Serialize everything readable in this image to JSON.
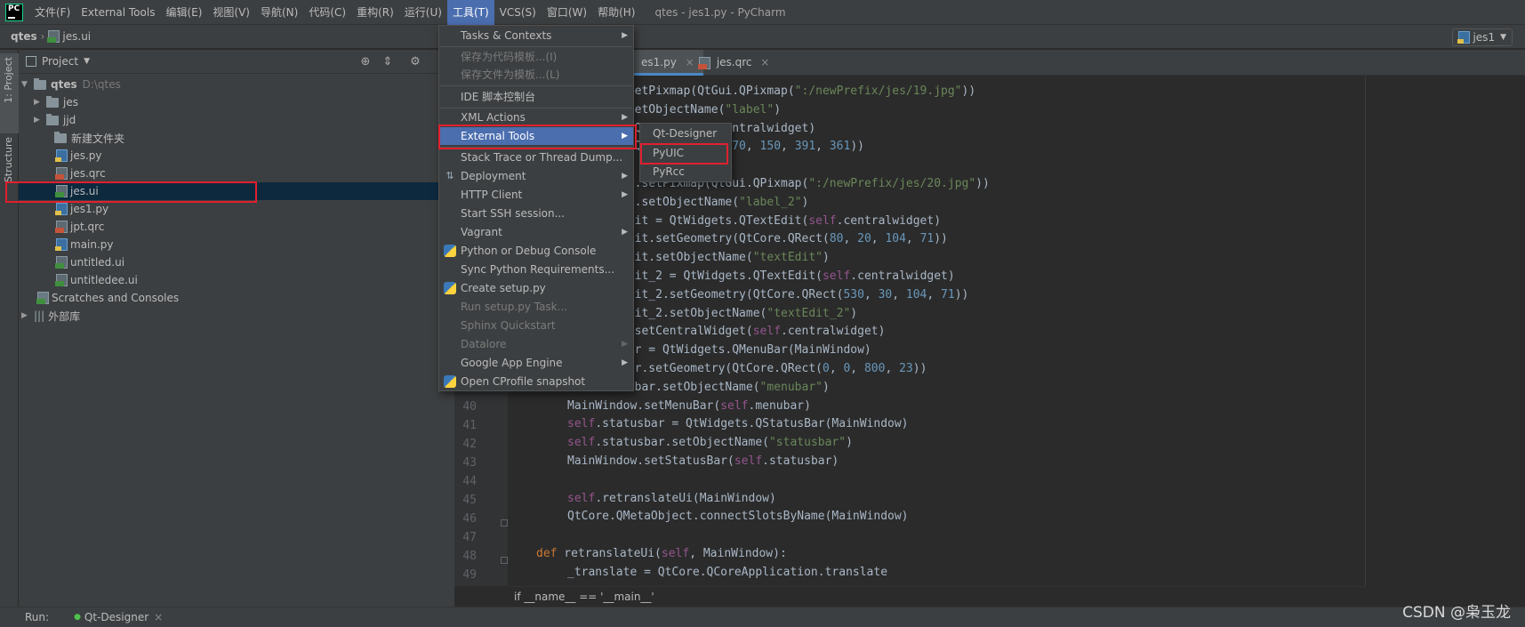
{
  "app": {
    "logo": "PC",
    "window_title": "qtes - jes1.py - PyCharm"
  },
  "menubar": [
    "文件(F)",
    "External Tools",
    "编辑(E)",
    "视图(V)",
    "导航(N)",
    "代码(C)",
    "重构(R)",
    "运行(U)",
    "工具(T)",
    "VCS(S)",
    "窗口(W)",
    "帮助(H)"
  ],
  "navbar": {
    "root": "qtes",
    "file": "jes.ui",
    "run_config": "jes1"
  },
  "sidebar": {
    "project_tab": "1: Project",
    "structure_tab": "Structure"
  },
  "project": {
    "title": "Project",
    "root": {
      "name": "qtes",
      "path": "D:\\qtes"
    },
    "items": [
      "jes",
      "jjd",
      "新建文件夹",
      "jes.py",
      "jes.qrc",
      "jes.ui",
      "jes1.py",
      "jpt.qrc",
      "main.py",
      "untitled.ui",
      "untitledee.ui"
    ],
    "scratches": "Scratches and Consoles",
    "external_libs": "外部库"
  },
  "editor_tabs": [
    "es1.py",
    "jes.qrc"
  ],
  "tools_menu": {
    "items": [
      "Tasks & Contexts",
      "保存为代码模板...(I)",
      "保存文件为模板...(L)",
      "IDE 脚本控制台",
      "XML Actions",
      "External Tools",
      "Stack Trace or Thread Dump...",
      "Deployment",
      "HTTP Client",
      "Start SSH session...",
      "Vagrant",
      "Python or Debug Console",
      "Sync Python Requirements...",
      "Create setup.py",
      "Run setup.py Task...",
      "Sphinx Quickstart",
      "Datalore",
      "Google App Engine",
      "Open CProfile snapshot"
    ]
  },
  "external_tools_menu": {
    "items": [
      "Qt-Designer",
      "PyUIC",
      "PyRcc"
    ]
  },
  "code": {
    "line_numbers": [
      "40",
      "41",
      "42",
      "43",
      "44",
      "45",
      "46",
      "47",
      "48",
      "49"
    ],
    "visible": [
      ".setPixmap(QtGui.QPixmap(\":/newPrefix/jes/19.jpg\"))",
      ".setObjectName(\"label\")",
      "s.QLabel(self.centralwidget)",
      "y(QtCore.QRect(370, 150, 391, 361))",
      ")",
      "_2.setPixmap(QtGui.QPixmap(\":/newPrefix/jes/20.jpg\"))",
      "_2.setObjectName(\"label_2\")",
      "Edit = QtWidgets.QTextEdit(self.centralwidget)",
      "Edit.setGeometry(QtCore.QRect(80, 20, 104, 71))",
      "Edit.setObjectName(\"textEdit\")",
      "Edit_2 = QtWidgets.QTextEdit(self.centralwidget)",
      "Edit_2.setGeometry(QtCore.QRect(530, 30, 104, 71))",
      "Edit_2.setObjectName(\"textEdit_2\")",
      "w.setCentralWidget(self.centralwidget)",
      "bar = QtWidgets.QMenuBar(MainWindow)",
      "bar.setGeometry(QtCore.QRect(0, 0, 800, 23))",
      "nubar.setObjectName(\"menubar\")",
      "MainWindow.setMenuBar(self.menubar)",
      "self.statusbar = QtWidgets.QStatusBar(MainWindow)",
      "self.statusbar.setObjectName(\"statusbar\")",
      "MainWindow.setStatusBar(self.statusbar)",
      "",
      "self.retranslateUi(MainWindow)",
      "QtCore.QMetaObject.connectSlotsByName(MainWindow)",
      "",
      "def retranslateUi(self, MainWindow):",
      "_translate = QtCore.QCoreApplication.translate"
    ],
    "breadcrumb": "if __name__ == '__main__'"
  },
  "bottom": {
    "run_label": "Run:",
    "run_tab": "Qt-Designer"
  },
  "watermark": "CSDN @枭玉龙",
  "colors": {
    "highlight": "#4b6eaf",
    "annotation_box": "#e0202e",
    "selection": "#0d293e"
  }
}
